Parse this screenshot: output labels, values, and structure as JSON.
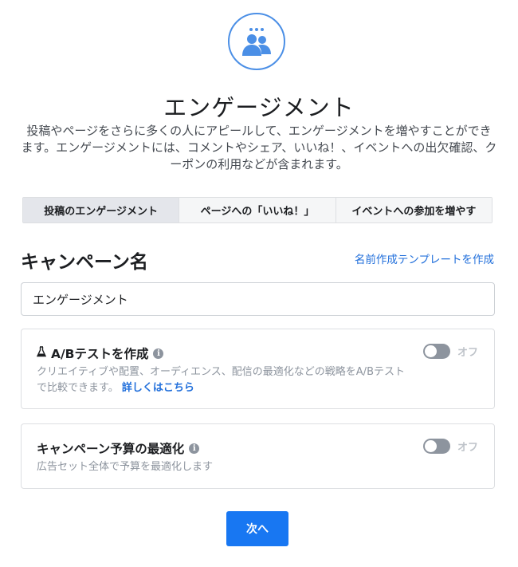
{
  "header": {
    "icon": "group-engagement-icon",
    "title": "エンゲージメント",
    "description": "投稿やページをさらに多くの人にアピールして、エンゲージメントを増やすことができます。エンゲージメントには、コメントやシェア、いいね！、イベントへの出欠確認、クーポンの利用などが含まれます。"
  },
  "tabs": [
    {
      "label": "投稿のエンゲージメント",
      "active": true
    },
    {
      "label": "ページへの「いいね！」",
      "active": false
    },
    {
      "label": "イベントへの参加を増やす",
      "active": false
    }
  ],
  "campaign_name": {
    "heading": "キャンペーン名",
    "template_link": "名前作成テンプレートを作成",
    "value": "エンゲージメント"
  },
  "ab_test": {
    "icon": "flask-icon",
    "title": "A/Bテストを作成",
    "description": "クリエイティブや配置、オーディエンス、配信の最適化などの戦略をA/Bテストで比較できます。",
    "learn_more": "詳しくはこちら",
    "toggle_label": "オフ",
    "toggle_on": false
  },
  "budget_optimization": {
    "title": "キャンペーン予算の最適化",
    "description": "広告セット全体で予算を最適化します",
    "toggle_label": "オフ",
    "toggle_on": false
  },
  "footer": {
    "next_label": "次へ"
  },
  "colors": {
    "accent": "#1877f2",
    "link": "#216fdb",
    "icon_ring": "#4b8fe6"
  }
}
